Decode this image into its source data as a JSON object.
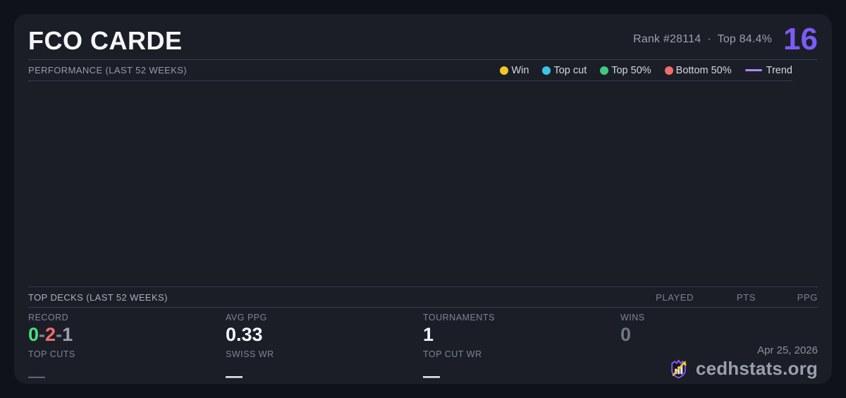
{
  "header": {
    "title": "FCO CARDE",
    "rank_text": "Rank #28114",
    "separator": "·",
    "top_percent": "Top 84.4%",
    "score": "16"
  },
  "performance": {
    "section_title": "PERFORMANCE (LAST 52 WEEKS)",
    "legend": [
      {
        "label": "Win",
        "color": "#f0c62f",
        "type": "dot"
      },
      {
        "label": "Top cut",
        "color": "#38c6e8",
        "type": "dot"
      },
      {
        "label": "Top 50%",
        "color": "#3ecb7e",
        "type": "dot"
      },
      {
        "label": "Bottom 50%",
        "color": "#f26b6b",
        "type": "dot"
      },
      {
        "label": "Trend",
        "color": "#a78bfa",
        "type": "line"
      }
    ],
    "chart_points": []
  },
  "top_decks": {
    "section_title": "TOP DECKS (LAST 52 WEEKS)",
    "columns": [
      "PLAYED",
      "PTS",
      "PPG"
    ],
    "rows": []
  },
  "stats": {
    "record": {
      "label": "RECORD",
      "wins": "0",
      "sep1": "-",
      "losses": "2",
      "sep2": "-",
      "draws": "1",
      "sub_label": "TOP CUTS",
      "sub_value": "—"
    },
    "avg_ppg": {
      "label": "AVG PPG",
      "value": "0.33",
      "sub_label": "SWISS WR",
      "sub_value": "—"
    },
    "tournaments": {
      "label": "TOURNAMENTS",
      "value": "1",
      "sub_label": "TOP CUT WR",
      "sub_value": "—"
    },
    "wins": {
      "label": "WINS",
      "value": "0"
    }
  },
  "footer": {
    "date": "Apr 25, 2026",
    "site": "cedhstats.org"
  },
  "colors": {
    "card_bg": "#1b1e27",
    "page_bg": "#101219",
    "accent_purple": "#7b5cf5",
    "trend_purple": "#a78bfa",
    "win_yellow": "#f0c62f",
    "topcut_cyan": "#38c6e8",
    "top50_green": "#3ecb7e",
    "bottom50_red": "#f26b6b",
    "record_win_green": "#4ade80",
    "record_loss_red": "#f36d6d",
    "logo_purple": "#8b5cf6",
    "logo_gold": "#f2c230"
  }
}
